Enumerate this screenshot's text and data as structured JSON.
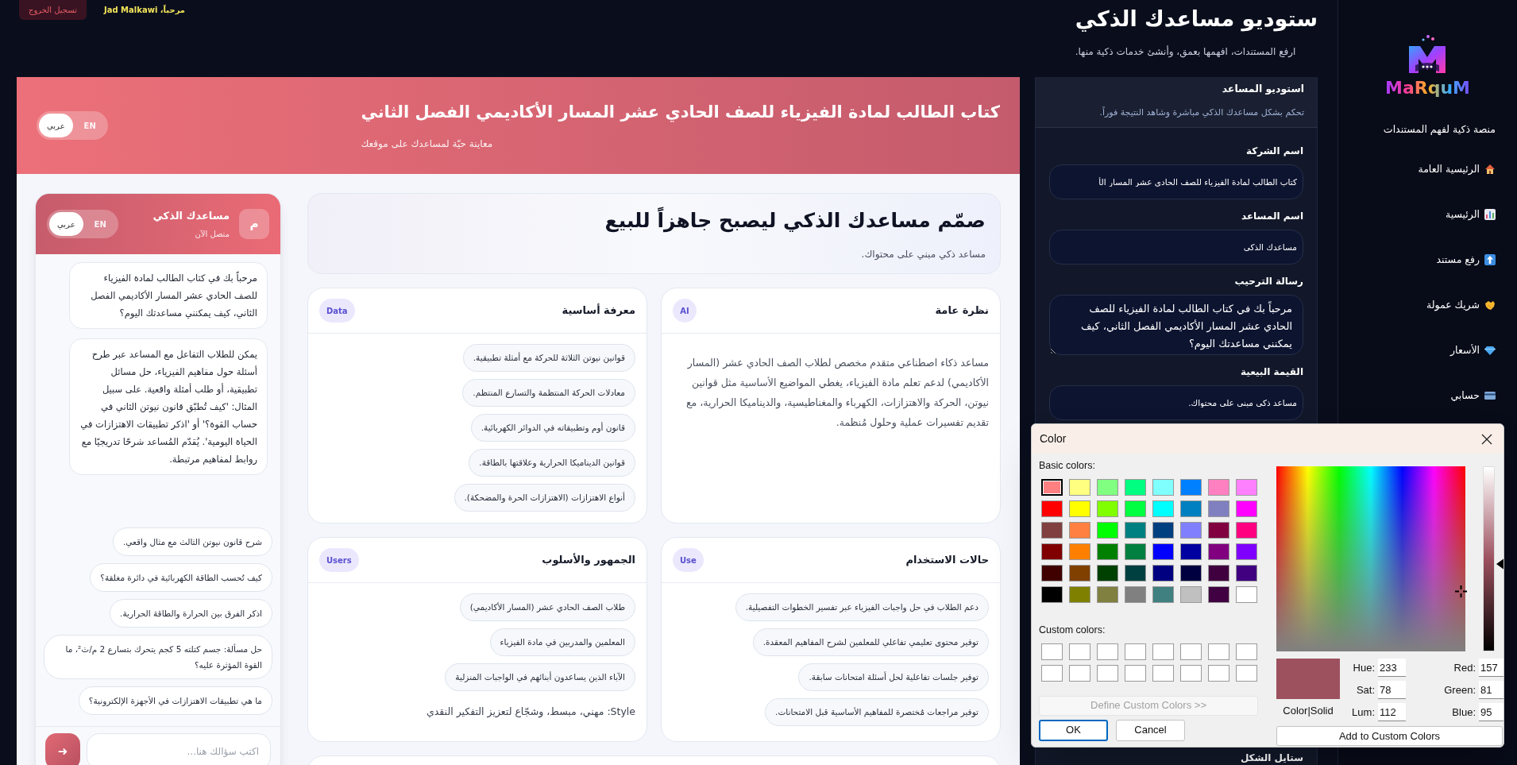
{
  "header": {
    "logout": "تسجيل الخروج",
    "greeting": "مرحباً، Jad Malkawi",
    "title": "ستوديو مساعدك الذكي",
    "subtitle": "ارفع المستندات، افهمها بعمق، وأنشئ خدمات ذكية منها."
  },
  "sidebar": {
    "logo": "MaRquM",
    "tagline": "منصة ذكية لفهم المستندات",
    "items": [
      {
        "kind": "house",
        "label": "الرئيسية العامة"
      },
      {
        "kind": "chart",
        "label": "الرئيسية"
      },
      {
        "kind": "upload",
        "label": "رفع مستند"
      },
      {
        "kind": "handshake",
        "label": "شريك عمولة"
      },
      {
        "kind": "gem",
        "label": "الأسعار"
      },
      {
        "kind": "card",
        "label": "حسابي"
      }
    ]
  },
  "preview": {
    "title": "كتاب الطالب لمادة الفيزياء للصف الحادي عشر المسار الأكاديمي الفصل الثاني",
    "subtitle": "معاينة حيّة لمساعدك على موقعك",
    "languages": [
      {
        "label": "EN",
        "selected": false
      },
      {
        "label": "عربي",
        "selected": true
      }
    ],
    "chat": {
      "avatar": "م",
      "name": "مساعدك الذكي",
      "status": "متصل الآن",
      "languages": [
        {
          "label": "EN",
          "selected": false
        },
        {
          "label": "عربي",
          "selected": true
        }
      ],
      "messages": [
        "مرحباً بك في كتاب الطالب لمادة الفيزياء للصف الحادي عشر المسار الأكاديمي الفصل الثاني، كيف يمكنني مساعدتك اليوم؟",
        "يمكن للطلاب التفاعل مع المساعد عبر طرح أسئلة حول مفاهيم الفيزياء، حل مسائل تطبيقية، أو طلب أمثلة واقعية. على سبيل المثال: 'كيف تُطبّق قانون نيوتن الثاني في حساب القوة؟' أو 'اذكر تطبيقات الاهتزازات في الحياة اليومية'. يُقدّم المُساعد شرحًا تدريجيًا مع روابط لمفاهيم مرتبطة."
      ],
      "suggestions": [
        "شرح قانون نيوتن الثالث مع مثال واقعي.",
        "كيف تُحسب الطاقة الكهربائية في دائرة مغلقة؟",
        "اذكر الفرق بين الحرارة والطاقة الحرارية.",
        "حل مسألة: جسم كتلته 5 كجم يتحرك بتسارع 2 م/ث²، ما القوة المؤثرة عليه؟",
        "ما هي تطبيقات الاهتزازات في الأجهزة الإلكترونية؟"
      ],
      "input_placeholder": "اكتب سؤالك هنا...",
      "send": "➜"
    },
    "hero": {
      "title": "صمّم مساعدك الذكي ليصبح جاهزاً للبيع",
      "subtitle": "مساعد ذكي مبني على محتواك."
    },
    "cards": [
      {
        "title": "نظرة عامة",
        "badge": "AI",
        "kind": "text",
        "text": "مساعد ذكاء اصطناعي متقدم مخصص لطلاب الصف الحادي عشر (المسار الأكاديمي) لدعم تعلم مادة الفيزياء، يغطي المواضيع الأساسية مثل قوانين نيوتن، الحركة والاهتزازات، الكهرباء والمغناطيسية، والديناميكا الحرارية، مع تقديم تفسيرات عملية وحلول مُنظمة."
      },
      {
        "title": "معرفة أساسية",
        "badge": "Data",
        "kind": "list",
        "items": [
          "قوانين نيوتن الثلاثة للحركة مع أمثلة تطبيقية.",
          "معادلات الحركة المنتظمة والتسارع المنتظم.",
          "قانون أوم وتطبيقاته في الدوائر الكهربائية.",
          "قوانين الديناميكا الحرارية وعلاقتها بالطاقة.",
          "أنواع الاهتزازات (الاهتزازات الحرة والمضحكة)."
        ]
      },
      {
        "title": "حالات الاستخدام",
        "badge": "Use",
        "kind": "list",
        "items": [
          "دعم الطلاب في حل واجبات الفيزياء عبر تفسير الخطوات التفصيلية.",
          "توفير محتوى تعليمي تفاعلي للمعلمين لشرح المفاهيم المعقدة.",
          "توفير جلسات تفاعلية لحل أسئلة امتحانات سابقة.",
          "توفير مراجعات مُختصرة للمفاهيم الأساسية قبل الامتحانات."
        ]
      },
      {
        "title": "الجمهور والأسلوب",
        "badge": "Users",
        "kind": "list",
        "items": [
          "طلاب الصف الحادي عشر (المسار الأكاديمي)",
          "المعلمين والمدربين في مادة الفيزياء",
          "الآباء الذين يساعدون أبنائهم في الواجبات المنزلية"
        ],
        "note": "Style: مهني، مبسط، وشجّاع لتعزيز التفكير النقدي"
      }
    ]
  },
  "studio": {
    "title": "استوديو المساعد",
    "subtitle": "تحكم بشكل مساعدك الذكي مباشرة وشاهد النتيجة فوراً.",
    "fields": [
      {
        "kind": "input",
        "label": "اسم الشركة",
        "value": "كتاب الطالب لمادة الفيزياء للصف الحادي عشر المسار الأ"
      },
      {
        "kind": "input",
        "label": "اسم المساعد",
        "value": "مساعدك الذكي"
      },
      {
        "kind": "textarea",
        "label": "رسالة الترحيب",
        "value": "مرحباً بك في كتاب الطالب لمادة الفيزياء للصف الحادي عشر المسار الأكاديمي الفصل الثاني، كيف يمكنني مساعدتك اليوم؟"
      },
      {
        "kind": "input",
        "label": "القيمة البيعية",
        "value": "مساعد ذكي مبني على محتواك."
      },
      {
        "kind": "label",
        "label": "ستايل الشكل"
      }
    ]
  },
  "color_dialog": {
    "title": "Color",
    "basic_label": "Basic colors:",
    "basic_colors": [
      {
        "color": "#ff8080",
        "selected": true
      },
      {
        "color": "#ffff80",
        "selected": false
      },
      {
        "color": "#80ff80",
        "selected": false
      },
      {
        "color": "#00ff80",
        "selected": false
      },
      {
        "color": "#80ffff",
        "selected": false
      },
      {
        "color": "#0080ff",
        "selected": false
      },
      {
        "color": "#ff80c0",
        "selected": false
      },
      {
        "color": "#ff80ff",
        "selected": false
      },
      {
        "color": "#ff0000",
        "selected": false
      },
      {
        "color": "#ffff00",
        "selected": false
      },
      {
        "color": "#80ff00",
        "selected": false
      },
      {
        "color": "#00ff40",
        "selected": false
      },
      {
        "color": "#00ffff",
        "selected": false
      },
      {
        "color": "#0080c0",
        "selected": false
      },
      {
        "color": "#8080c0",
        "selected": false
      },
      {
        "color": "#ff00ff",
        "selected": false
      },
      {
        "color": "#804040",
        "selected": false
      },
      {
        "color": "#ff8040",
        "selected": false
      },
      {
        "color": "#00ff00",
        "selected": false
      },
      {
        "color": "#008080",
        "selected": false
      },
      {
        "color": "#004080",
        "selected": false
      },
      {
        "color": "#8080ff",
        "selected": false
      },
      {
        "color": "#800040",
        "selected": false
      },
      {
        "color": "#ff0080",
        "selected": false
      },
      {
        "color": "#800000",
        "selected": false
      },
      {
        "color": "#ff8000",
        "selected": false
      },
      {
        "color": "#008000",
        "selected": false
      },
      {
        "color": "#008040",
        "selected": false
      },
      {
        "color": "#0000ff",
        "selected": false
      },
      {
        "color": "#0000a0",
        "selected": false
      },
      {
        "color": "#800080",
        "selected": false
      },
      {
        "color": "#8000ff",
        "selected": false
      },
      {
        "color": "#400000",
        "selected": false
      },
      {
        "color": "#804000",
        "selected": false
      },
      {
        "color": "#004000",
        "selected": false
      },
      {
        "color": "#004040",
        "selected": false
      },
      {
        "color": "#000080",
        "selected": false
      },
      {
        "color": "#000040",
        "selected": false
      },
      {
        "color": "#400040",
        "selected": false
      },
      {
        "color": "#400080",
        "selected": false
      },
      {
        "color": "#000000",
        "selected": false
      },
      {
        "color": "#808000",
        "selected": false
      },
      {
        "color": "#808040",
        "selected": false
      },
      {
        "color": "#808080",
        "selected": false
      },
      {
        "color": "#408080",
        "selected": false
      },
      {
        "color": "#c0c0c0",
        "selected": false
      },
      {
        "color": "#400041",
        "selected": false
      },
      {
        "color": "#ffffff",
        "selected": false
      }
    ],
    "custom_label": "Custom colors:",
    "define_button": {
      "label": "Define Custom Colors >>",
      "disabled": true
    },
    "ok": "OK",
    "cancel": "Cancel",
    "preview_label": "Color|Solid",
    "hsl_values": [
      {
        "label": "Hue:",
        "value": "233"
      },
      {
        "label": "Sat:",
        "value": "78"
      },
      {
        "label": "Lum:",
        "value": "112"
      }
    ],
    "rgb_values": [
      {
        "label": "Red:",
        "value": "157"
      },
      {
        "label": "Green:",
        "value": "81"
      },
      {
        "label": "Blue:",
        "value": "95"
      }
    ],
    "add_button": "Add to Custom Colors",
    "lum_slider": {
      "level": 0.47
    }
  }
}
